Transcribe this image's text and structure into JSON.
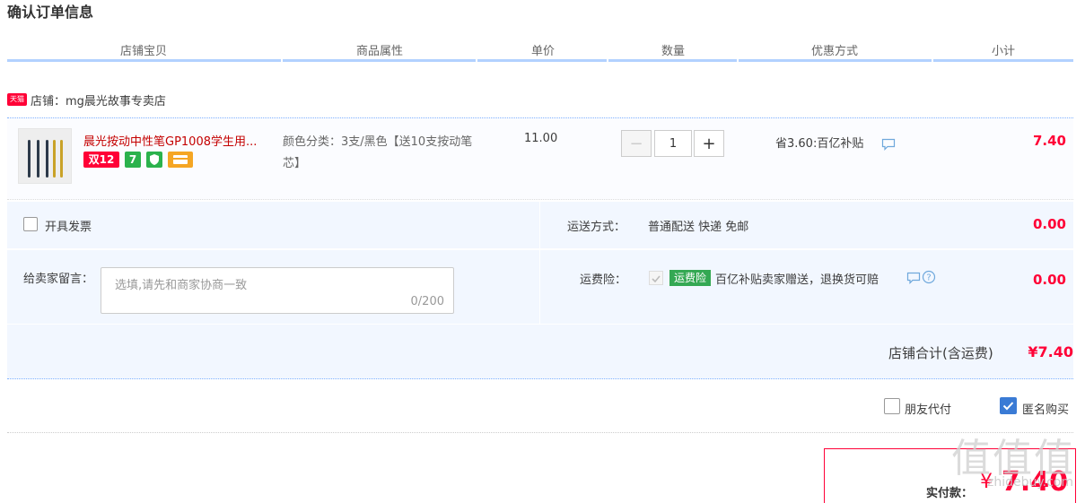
{
  "page_title": "确认订单信息",
  "columns": [
    "店铺宝贝",
    "商品属性",
    "单价",
    "数量",
    "优惠方式",
    "小计"
  ],
  "shop": {
    "icon_text": "天猫",
    "label": "店铺：mg晨光故事专卖店"
  },
  "item": {
    "name": "晨光按动中性笔GP1008学生用...",
    "badges": [
      "双12",
      "7",
      "",
      ""
    ],
    "attribute": "颜色分类：3支/黑色【送10支按动笔芯】",
    "unit_price": "11.00",
    "quantity": "1",
    "minus": "−",
    "plus": "+",
    "discount": "省3.60:百亿补贴",
    "subtotal": "7.40"
  },
  "invoice": {
    "label": "开具发票"
  },
  "shipping": {
    "label": "运送方式：",
    "value": "普通配送 快递 免邮",
    "amount": "0.00"
  },
  "message": {
    "label": "给卖家留言：",
    "placeholder": "选填,请先和商家协商一致",
    "counter": "0/200"
  },
  "insurance": {
    "label": "运费险：",
    "badge": "运费险",
    "desc": "百亿补贴卖家赠送，退换货可赔",
    "amount": "0.00"
  },
  "shop_total": {
    "label": "店铺合计(含运费)",
    "amount": "¥7.40"
  },
  "options": {
    "friend_pay": "朋友代付",
    "anonymous": "匿名购买"
  },
  "payment": {
    "label": "实付款：",
    "currency": "¥",
    "amount": "7.40"
  },
  "watermark": {
    "chars": "值值值",
    "site": "zhidebuy.com"
  },
  "colors": {
    "accent": "#ff0036",
    "header_bar": "#b2d1ff",
    "panel": "#f2f7ff",
    "check_blue": "#3a7bd5"
  }
}
